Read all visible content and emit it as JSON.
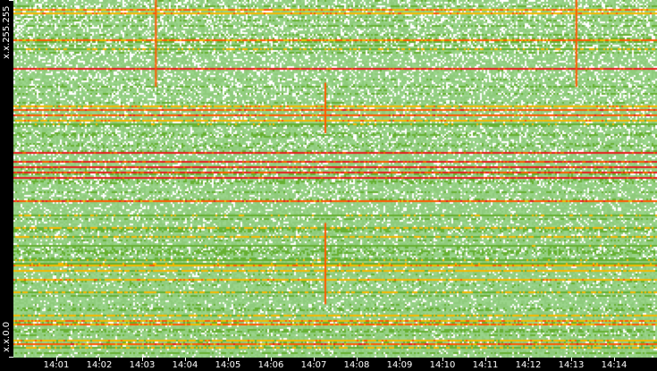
{
  "chart_data": {
    "type": "heatmap",
    "title": "",
    "xlabel": "",
    "ylabel": "",
    "x_start_minute": 0,
    "x_end_minute": 15,
    "x_tick_minutes": [
      1,
      2,
      3,
      4,
      5,
      6,
      7,
      8,
      9,
      10,
      11,
      12,
      13,
      14
    ],
    "x_tick_labels": [
      "14:01",
      "14:02",
      "14:03",
      "14:04",
      "14:05",
      "14:06",
      "14:07",
      "14:08",
      "14:09",
      "14:10",
      "14:11",
      "14:12",
      "14:13",
      "14:14"
    ],
    "y_labels": {
      "top": "x.x.255.255",
      "bottom": "x.x.0.0"
    },
    "y_range": [
      0,
      255
    ],
    "hot_rows": [
      {
        "octet": 248,
        "level": 0.7
      },
      {
        "octet": 227,
        "level": 0.75
      },
      {
        "octet": 207,
        "level": 0.95
      },
      {
        "octet": 177,
        "level": 0.8
      },
      {
        "octet": 173,
        "level": 0.8
      },
      {
        "octet": 146,
        "level": 0.95
      },
      {
        "octet": 140,
        "level": 0.9
      },
      {
        "octet": 136,
        "level": 0.95
      },
      {
        "octet": 132,
        "level": 0.9
      },
      {
        "octet": 129,
        "level": 0.95
      },
      {
        "octet": 112,
        "level": 0.8
      },
      {
        "octet": 24,
        "level": 0.75
      },
      {
        "octet": 10,
        "level": 0.8
      }
    ],
    "vertical_bursts": [
      {
        "minute": 3.3,
        "octet_from": 193,
        "octet_to": 255
      },
      {
        "minute": 13.1,
        "octet_from": 193,
        "octet_to": 255
      },
      {
        "minute": 7.25,
        "octet_from": 160,
        "octet_to": 196
      },
      {
        "minute": 7.25,
        "octet_from": 38,
        "octet_to": 96
      }
    ],
    "colors": {
      "low": "#8fcb7c",
      "mid": "#66b030",
      "high": "#f5b800",
      "hot": "#ff5a00",
      "max": "#e81c1c",
      "empty": "#ffffff"
    }
  }
}
